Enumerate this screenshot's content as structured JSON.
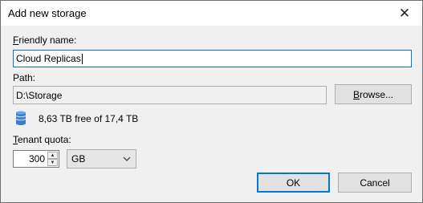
{
  "window": {
    "title": "Add new storage",
    "close_glyph": "✕"
  },
  "friendly_name": {
    "label_accel": "F",
    "label_rest": "riendly name:",
    "value": "Cloud Replicas"
  },
  "path": {
    "label": "Path:",
    "value": "D:\\Storage",
    "browse_accel": "B",
    "browse_rest": "rowse..."
  },
  "storage_info": {
    "icon": "database-icon",
    "free_text": "8,63 TB free of 17,4 TB"
  },
  "tenant_quota": {
    "label_accel": "T",
    "label_rest": "enant quota:",
    "value": "300",
    "unit": "GB"
  },
  "buttons": {
    "ok": "OK",
    "cancel": "Cancel"
  },
  "colors": {
    "accent": "#0078d7",
    "db_icon": "#3a7fc9"
  }
}
